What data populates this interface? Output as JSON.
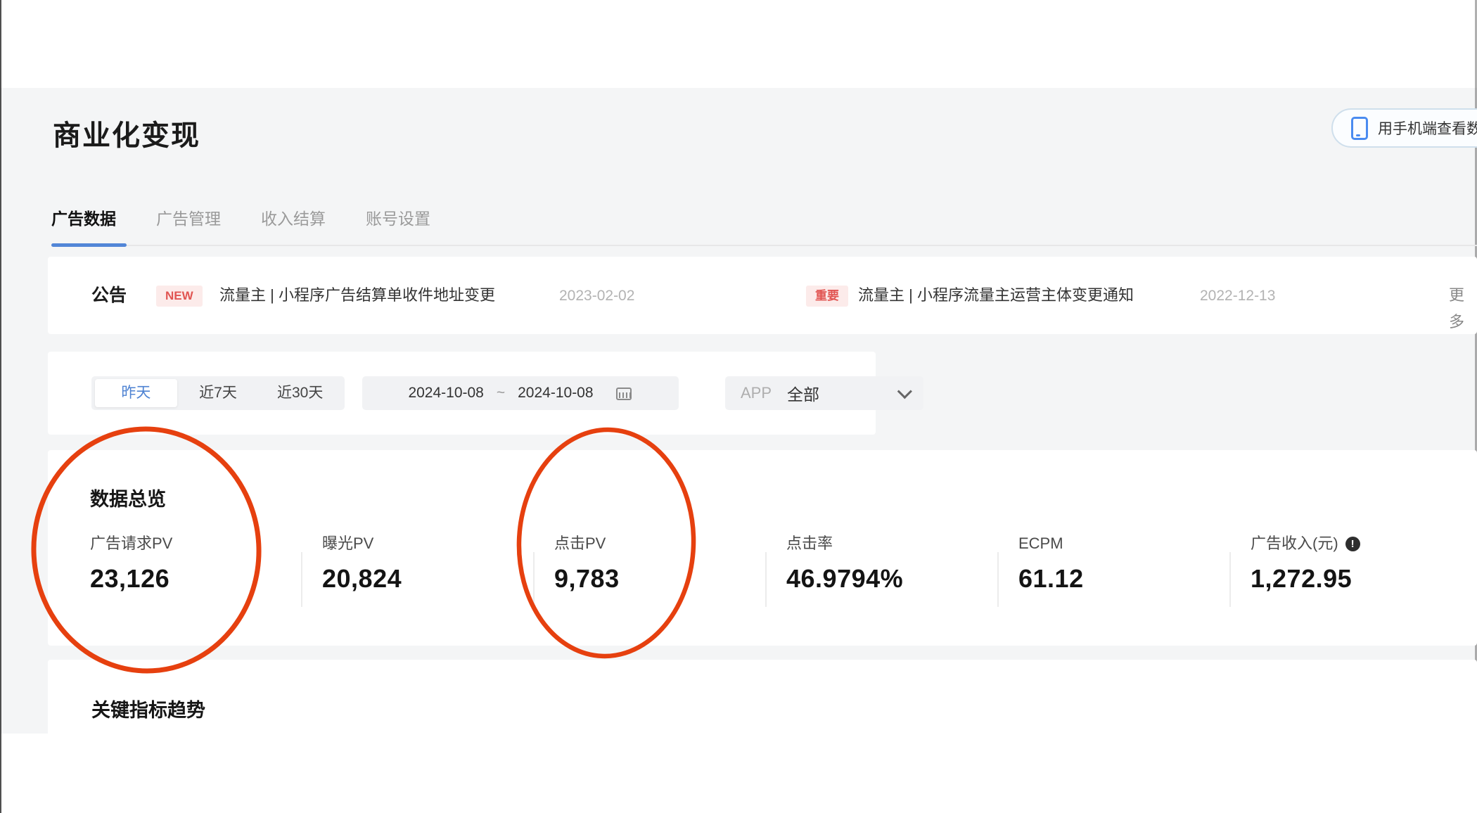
{
  "page": {
    "title": "商业化变现"
  },
  "header_button": {
    "label": "用手机端查看数据",
    "icon": "phone-icon"
  },
  "tabs": [
    {
      "label": "广告数据",
      "active": true
    },
    {
      "label": "广告管理",
      "active": false
    },
    {
      "label": "收入结算",
      "active": false
    },
    {
      "label": "账号设置",
      "active": false
    }
  ],
  "announcement": {
    "title": "公告",
    "items": [
      {
        "badge": "NEW",
        "text": "流量主 | 小程序广告结算单收件地址变更",
        "date": "2023-02-02"
      },
      {
        "badge": "重要",
        "text": "流量主 | 小程序流量主运营主体变更通知",
        "date": "2022-12-13"
      }
    ],
    "more_label": "更多"
  },
  "filters": {
    "quick_ranges": [
      "昨天",
      "近7天",
      "近30天"
    ],
    "selected_range": "昨天",
    "date_start": "2024-10-08",
    "date_separator": "~",
    "date_end": "2024-10-08",
    "calendar_icon": "calendar-icon",
    "app_label": "APP",
    "app_value": "全部",
    "app_chevron_icon": "chevron-down-icon"
  },
  "overview": {
    "title": "数据总览",
    "metrics": [
      {
        "label": "广告请求PV",
        "value": "23,126",
        "circled": true
      },
      {
        "label": "曝光PV",
        "value": "20,824",
        "circled": false
      },
      {
        "label": "点击PV",
        "value": "9,783",
        "circled": true
      },
      {
        "label": "点击率",
        "value": "46.9794%",
        "circled": false
      },
      {
        "label": "ECPM",
        "value": "61.12",
        "circled": false
      },
      {
        "label": "广告收入(元)",
        "value": "1,272.95",
        "circled": false,
        "info_icon": "info-icon",
        "info_glyph": "!"
      }
    ]
  },
  "trend": {
    "title": "关键指标趋势"
  },
  "colors": {
    "accent_blue": "#5286d7",
    "badge_text_red": "#e15552",
    "badge_bg_pink": "#fcebea",
    "annotation_red": "#e6400f",
    "page_band_gray": "#f4f5f6"
  }
}
